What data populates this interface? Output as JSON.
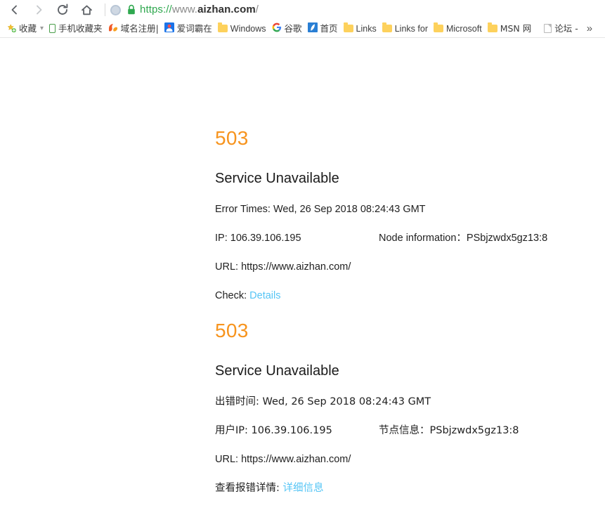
{
  "browser": {
    "nav": {
      "back_label": "Back",
      "forward_label": "Forward",
      "reload_label": "Reload",
      "home_label": "Home"
    },
    "omnibox": {
      "scheme": "https://",
      "host_prefix": "www.",
      "host_strong": "aizhan.com",
      "path": "/",
      "security_label": "Secure",
      "page_info_label": "Page info"
    },
    "bookmarks": [
      {
        "icon": "star-favorites-icon",
        "label": "收藏",
        "has_chevron": true
      },
      {
        "icon": "phone-icon",
        "label": "手机收藏夹",
        "has_chevron": false
      },
      {
        "icon": "domain-register-icon",
        "label": "域名注册|",
        "has_chevron": false
      },
      {
        "icon": "iciba-icon",
        "label": "爱词霸在",
        "has_chevron": false
      },
      {
        "icon": "folder-icon",
        "label": "Windows",
        "has_chevron": false
      },
      {
        "icon": "google-g-icon",
        "label": "谷歌",
        "has_chevron": false
      },
      {
        "icon": "sohu-home-icon",
        "label": "首页",
        "has_chevron": false
      },
      {
        "icon": "folder-icon",
        "label": "Links",
        "has_chevron": false
      },
      {
        "icon": "folder-icon",
        "label": "Links for",
        "has_chevron": false
      },
      {
        "icon": "folder-icon",
        "label": "Microsoft",
        "has_chevron": false
      },
      {
        "icon": "folder-icon",
        "label": "MSN 网",
        "has_chevron": false
      },
      {
        "icon": "document-icon",
        "label": "论坛 -",
        "has_chevron": false
      }
    ],
    "bookmarks_overflow_label": "»"
  },
  "content": {
    "blocks": [
      {
        "code": "503",
        "title": "Service Unavailable",
        "time_line": "Error Times: Wed, 26 Sep 2018 08:24:43 GMT",
        "ip_line": "IP: 106.39.106.195",
        "node_line": "Node information：PSbjzwdx5gz13:8",
        "url_line": "URL: https://www.aizhan.com/",
        "check_label": "Check:",
        "check_link": "Details"
      },
      {
        "code": "503",
        "title": "Service Unavailable",
        "time_line": "出错时间: Wed, 26 Sep 2018 08:24:43 GMT",
        "ip_line": "用户IP: 106.39.106.195",
        "node_line": "节点信息：PSbjzwdx5gz13:8",
        "url_line": "URL: https://www.aizhan.com/",
        "check_label": "查看报错详情:",
        "check_link": "详细信息"
      }
    ]
  },
  "colors": {
    "error_code": "#f7941e",
    "link": "#56c5f5",
    "secure_green": "#2fa84f",
    "folder_yellow": "#fdd15c"
  }
}
